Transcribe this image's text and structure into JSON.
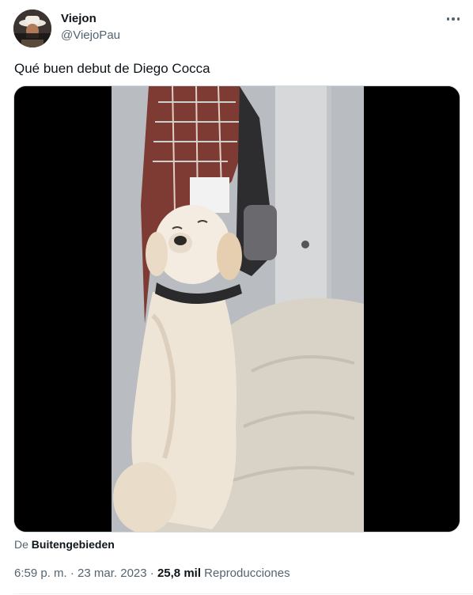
{
  "tweet": {
    "author_name": "Viejon",
    "author_handle": "@ViejoPau",
    "text": "Qué buen debut de Diego Cocca",
    "media": {
      "description_icon": "video-player",
      "source_prefix": "De",
      "source_name": "Buitengebieden"
    },
    "time": "6:59 p. m.",
    "separator": "·",
    "date": "23 mar. 2023",
    "views_count": "25,8 mil",
    "views_label": "Reproducciones"
  },
  "colors": {
    "text_primary": "#0f1419",
    "text_secondary": "#536471",
    "media_letterbox": "#000000"
  }
}
